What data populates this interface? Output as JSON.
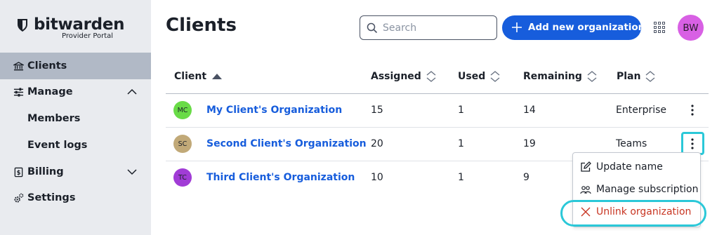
{
  "brand": {
    "name": "bitwarden",
    "subtitle": "Provider Portal"
  },
  "sidebar": {
    "items": [
      {
        "label": "Clients",
        "icon": "bank-icon",
        "active": true
      },
      {
        "label": "Manage",
        "icon": "sliders-icon",
        "expanded": true
      },
      {
        "label": "Members",
        "sub": true
      },
      {
        "label": "Event logs",
        "sub": true
      },
      {
        "label": "Billing",
        "icon": "billing-icon",
        "expanded": false
      },
      {
        "label": "Settings",
        "icon": "cogs-icon"
      }
    ]
  },
  "header": {
    "title": "Clients",
    "search_placeholder": "Search",
    "add_button_label": "Add new organization",
    "avatar_initials": "BW"
  },
  "table": {
    "columns": [
      "Client",
      "Assigned",
      "Used",
      "Remaining",
      "Plan"
    ],
    "rows": [
      {
        "initials": "MC",
        "avatar_color": "#69db47",
        "name": "My Client's Organization",
        "assigned": "15",
        "used": "1",
        "remaining": "14",
        "plan": "Enterprise"
      },
      {
        "initials": "SC",
        "avatar_color": "#c1a978",
        "name": "Second Client's Organization",
        "assigned": "20",
        "used": "1",
        "remaining": "19",
        "plan": "Teams"
      },
      {
        "initials": "TC",
        "avatar_color": "#a13cd6",
        "name": "Third Client's Organization",
        "assigned": "10",
        "used": "1",
        "remaining": "9",
        "plan": ""
      }
    ]
  },
  "menu": {
    "items": [
      {
        "label": "Update name",
        "icon": "edit-icon"
      },
      {
        "label": "Manage subscription",
        "icon": "users-icon"
      },
      {
        "label": "Unlink organization",
        "icon": "close-icon",
        "danger": true
      }
    ]
  },
  "colors": {
    "primary": "#175ddc",
    "danger": "#c83522",
    "highlight": "#2bc8d8",
    "sidebar_bg": "#e9ebef",
    "sidebar_active": "#b1b9c6"
  }
}
